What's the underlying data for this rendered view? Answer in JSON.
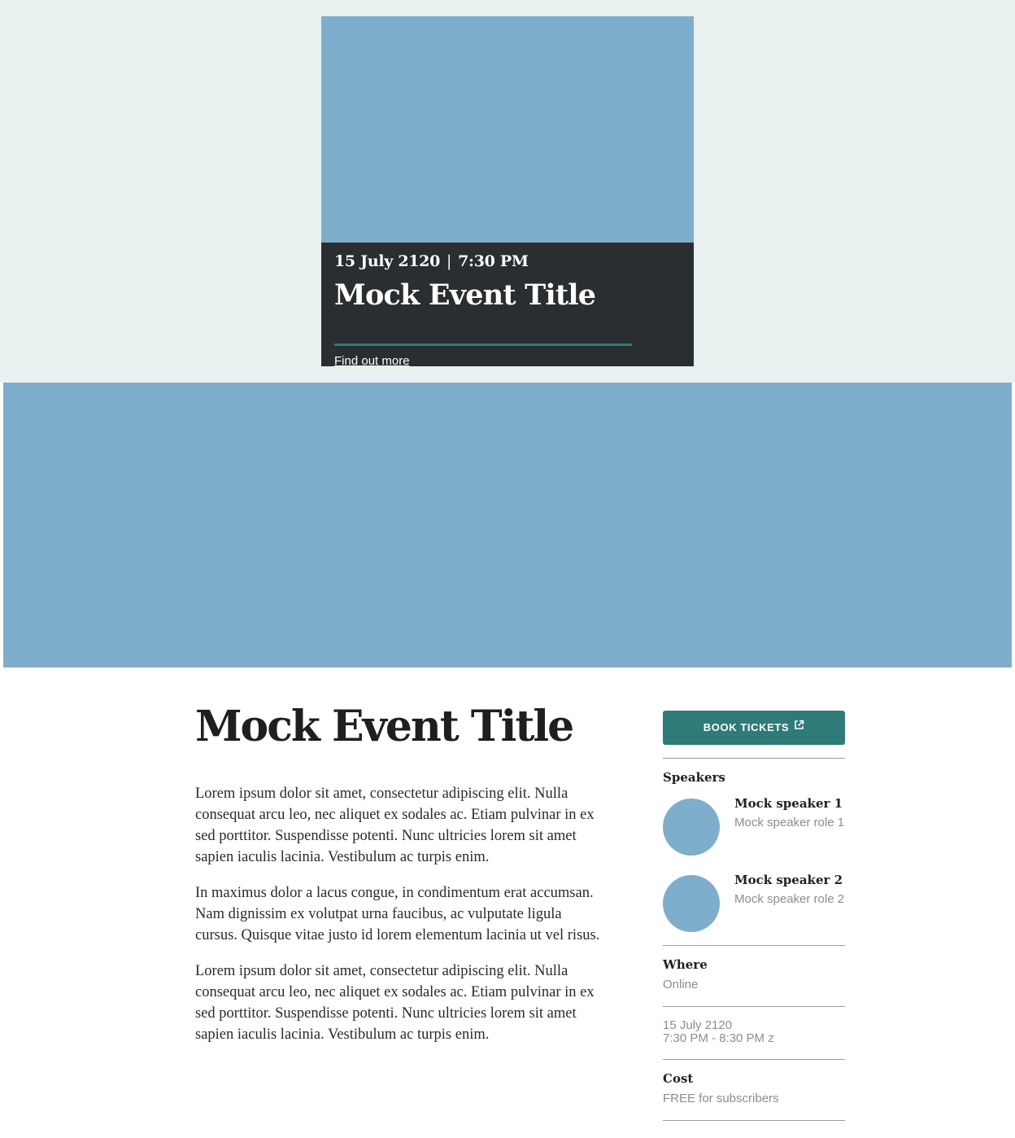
{
  "promo": {
    "date": "15 July 2120",
    "separator": "|",
    "time": "7:30 PM",
    "title": "Mock Event Title",
    "link_label": "Find out more"
  },
  "event": {
    "title": "Mock Event Title",
    "paragraphs": [
      "Lorem ipsum dolor sit amet, consectetur adipiscing elit. Nulla consequat arcu leo, nec aliquet ex sodales ac. Etiam pulvinar in ex sed porttitor. Suspendisse potenti. Nunc ultricies lorem sit amet sapien iaculis lacinia. Vestibulum ac turpis enim.",
      "In maximus dolor a lacus congue, in condimentum erat accumsan. Nam dignissim ex volutpat urna faucibus, ac vulputate ligula cursus. Quisque vitae justo id lorem elementum lacinia ut vel risus.",
      "Lorem ipsum dolor sit amet, consectetur adipiscing elit. Nulla consequat arcu leo, nec aliquet ex sodales ac. Etiam pulvinar in ex sed porttitor. Suspendisse potenti. Nunc ultricies lorem sit amet sapien iaculis lacinia. Vestibulum ac turpis enim."
    ]
  },
  "sidebar": {
    "book_label": "BOOK TICKETS",
    "book_icon": "external-link-icon",
    "speakers_heading": "Speakers",
    "speakers": [
      {
        "name": "Mock speaker 1",
        "role": "Mock speaker role 1"
      },
      {
        "name": "Mock speaker 2",
        "role": "Mock speaker role 2"
      }
    ],
    "where_heading": "Where",
    "where_value": "Online",
    "date": "15 July 2120",
    "time_range": "7:30 PM - 8:30 PM z",
    "cost_heading": "Cost",
    "cost_value": "FREE for subscribers"
  },
  "colors": {
    "accent": "#2e7b79",
    "image_placeholder": "#7fadcc",
    "promo_background": "#e9f1f0",
    "card_dark": "#2a2e31",
    "muted_text": "#8c8c8c"
  }
}
